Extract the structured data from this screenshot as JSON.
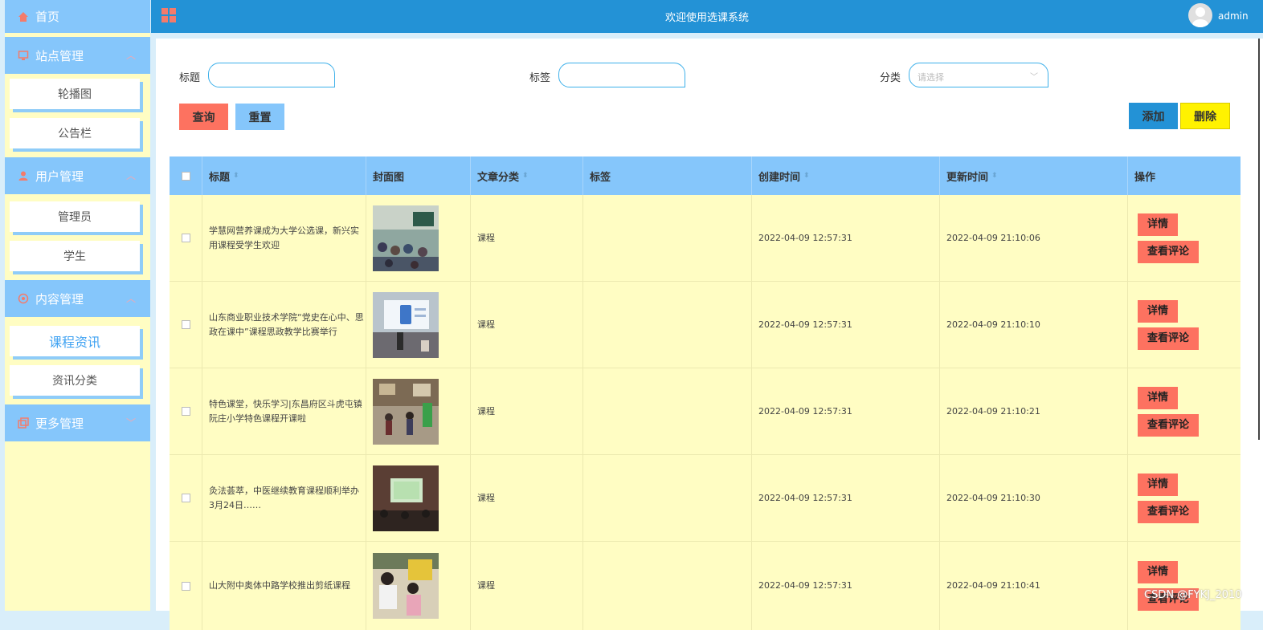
{
  "header": {
    "title": "欢迎使用选课系统",
    "username": "admin"
  },
  "sidebar": {
    "home": "首页",
    "groups": [
      {
        "label": "站点管理",
        "icon": "monitor-icon",
        "items": [
          "轮播图",
          "公告栏"
        ]
      },
      {
        "label": "用户管理",
        "icon": "user-icon",
        "items": [
          "管理员",
          "学生"
        ]
      },
      {
        "label": "内容管理",
        "icon": "content-icon",
        "items": [
          "课程资讯",
          "资讯分类"
        ],
        "active": "课程资讯"
      },
      {
        "label": "更多管理",
        "icon": "copy-icon",
        "items": []
      }
    ]
  },
  "search": {
    "title_label": "标题",
    "tag_label": "标签",
    "category_label": "分类",
    "category_placeholder": "请选择",
    "query_button": "查询",
    "reset_button": "重置",
    "add_button": "添加",
    "delete_button": "删除"
  },
  "table": {
    "columns": [
      "标题",
      "封面图",
      "文章分类",
      "标签",
      "创建时间",
      "更新时间",
      "操作"
    ],
    "rows": [
      {
        "title": "学慧网营养课成为大学公选课，新兴实用课程受学生欢迎",
        "category": "课程",
        "tags": "",
        "created": "2022-04-09 12:57:31",
        "updated": "2022-04-09 21:10:06"
      },
      {
        "title": "山东商业职业技术学院“党史在心中、思政在课中”课程思政教学比赛举行",
        "category": "课程",
        "tags": "",
        "created": "2022-04-09 12:57:31",
        "updated": "2022-04-09 21:10:10"
      },
      {
        "title": "特色课堂，快乐学习|东昌府区斗虎屯镇阮庄小学特色课程开课啦",
        "category": "课程",
        "tags": "",
        "created": "2022-04-09 12:57:31",
        "updated": "2022-04-09 21:10:21"
      },
      {
        "title": "灸法荟萃，中医继续教育课程顺利举办 3月24日……",
        "category": "课程",
        "tags": "",
        "created": "2022-04-09 12:57:31",
        "updated": "2022-04-09 21:10:30"
      },
      {
        "title": "山大附中奥体中路学校推出剪纸课程",
        "category": "课程",
        "tags": "",
        "created": "2022-04-09 12:57:31",
        "updated": "2022-04-09 21:10:41"
      }
    ],
    "detail_button": "详情",
    "comment_button": "查看评论"
  },
  "watermark": "CSDN @FYKJ_2010",
  "colors": {
    "header": "#2392d6",
    "sidebar_head": "#85c6fb",
    "sidebar_bg": "#fffdc3",
    "danger": "#fd7260",
    "add": "#2392d6",
    "delete": "#fff200"
  }
}
